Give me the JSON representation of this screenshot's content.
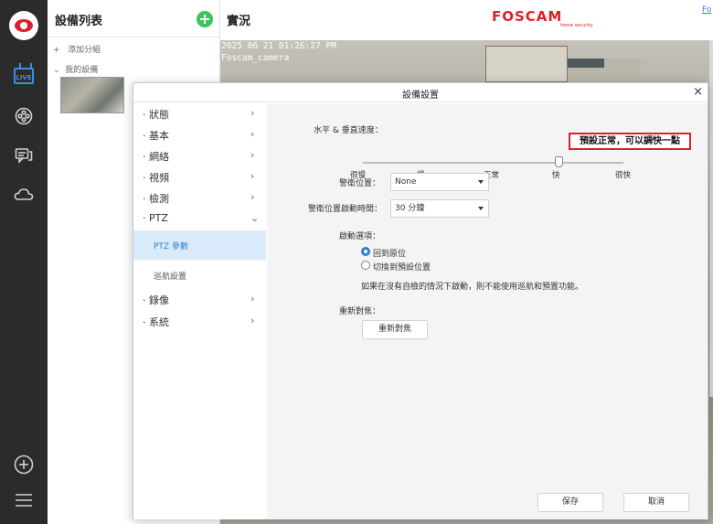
{
  "sidebar_rail": {
    "live_label": "LIVE",
    "icons": [
      "app-logo-icon",
      "live-view-icon",
      "playback-reel-icon",
      "messages-icon",
      "cloud-icon",
      "add-circle-icon",
      "menu-icon"
    ]
  },
  "device_panel": {
    "title": "設備列表",
    "add_button": "+",
    "add_group": "添加分組",
    "my_devices": "我的設備"
  },
  "main_header": {
    "title": "實況",
    "brand": "FOSCAM",
    "brand_sub": "home security",
    "corner_link": "Fo"
  },
  "camera_feed": {
    "timestamp": "2025 06 21 01:26:27 PM",
    "camera_name": "Foscam_camera"
  },
  "dialog": {
    "title": "設備設置",
    "close": "×",
    "nav": {
      "status": "· 狀態",
      "basic": "· 基本",
      "network": "· 網絡",
      "video": "· 視頻",
      "detection": "· 檢測",
      "ptz": "· PTZ",
      "ptz_params": "PTZ 參數",
      "cruise": "巡航設置",
      "record": "· 錄像",
      "system": "· 系統"
    },
    "speed_label": "水平 & 垂直速度：",
    "annotation": "預設正常，可以調快一點",
    "speed_ticks": [
      "很慢",
      "慢",
      "正常",
      "快",
      "很快"
    ],
    "speed_selected": "快",
    "speed_level_fraction": 0.75,
    "preset_pos_label": "警衛位置：",
    "preset_pos_value": "None",
    "preset_time_label": "警衛位置啟動時間：",
    "preset_time_value": "30 分鐘",
    "boot_label": "啟動選項：",
    "boot_option_1": "回到原位",
    "boot_option_2": "切換到預設位置",
    "boot_selected": "回到原位",
    "boot_note": "如果在沒有自檢的情況下啟動，則不能使用巡航和預置功能。",
    "refocus_label": "重新對焦：",
    "refocus_button": "重新對焦",
    "save": "保存",
    "cancel": "取消"
  },
  "colors": {
    "brand_red": "#d8232a",
    "accent_blue": "#2a7fd6",
    "add_green": "#3cc35a",
    "rail_dark": "#2b2b2b"
  }
}
